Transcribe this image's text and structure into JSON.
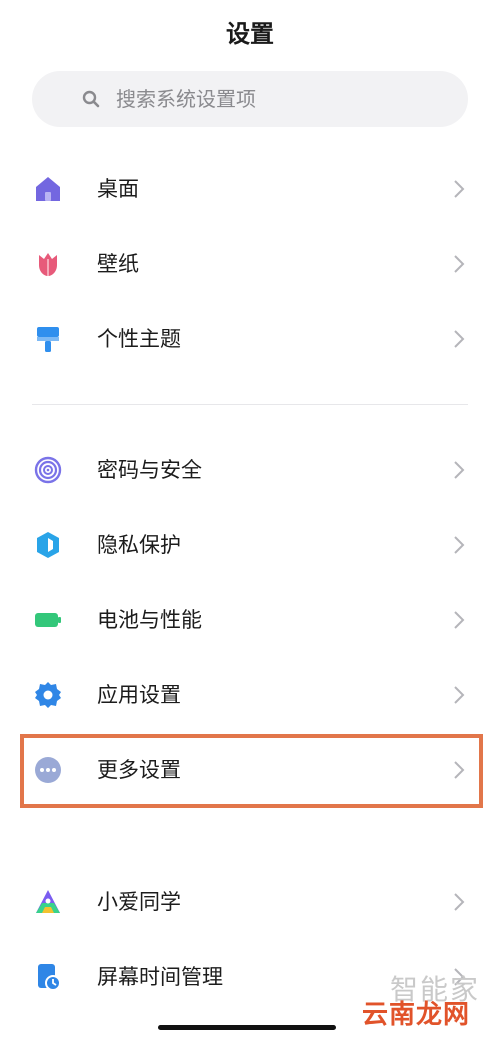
{
  "header": {
    "title": "设置"
  },
  "search": {
    "placeholder": "搜索系统设置项"
  },
  "groups": [
    {
      "items": [
        {
          "label": "桌面",
          "icon": "home-icon"
        },
        {
          "label": "壁纸",
          "icon": "tulip-wallpaper-icon"
        },
        {
          "label": "个性主题",
          "icon": "paint-roller-icon"
        }
      ]
    },
    {
      "items": [
        {
          "label": "密码与安全",
          "icon": "fingerprint-icon"
        },
        {
          "label": "隐私保护",
          "icon": "privacy-shield-icon"
        },
        {
          "label": "电池与性能",
          "icon": "battery-icon"
        },
        {
          "label": "应用设置",
          "icon": "gear-icon"
        },
        {
          "label": "更多设置",
          "icon": "more-dots-icon",
          "highlighted": true
        }
      ]
    },
    {
      "items": [
        {
          "label": "小爱同学",
          "icon": "xiaoai-assistant-icon"
        },
        {
          "label": "屏幕时间管理",
          "icon": "screen-time-icon"
        }
      ]
    }
  ],
  "colors": {
    "highlight_border": "#e2764a",
    "home_icon": "#7367e0",
    "wallpaper_icon": "#e75a7a",
    "theme_icon": "#2f8fee",
    "password_icon": "#7a73e8",
    "privacy_icon": "#29a4e8",
    "battery_icon": "#33c77a",
    "app_settings_icon": "#2f86e6",
    "more_icon": "#9aa9d6"
  },
  "watermark": {
    "line1": "智能家",
    "line2": "云南龙网"
  }
}
